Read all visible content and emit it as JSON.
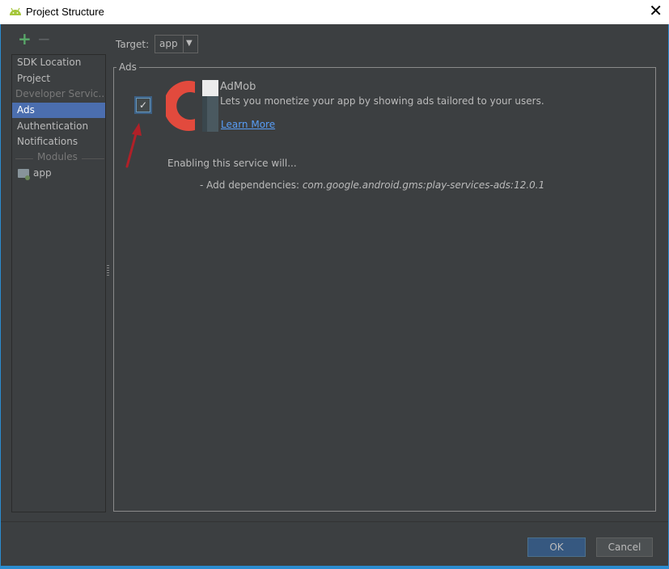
{
  "window": {
    "title": "Project Structure",
    "close_glyph": "✕"
  },
  "toolbar": {
    "add": "+",
    "remove": "−"
  },
  "sidebar": {
    "items": [
      {
        "label": "SDK Location"
      },
      {
        "label": "Project"
      },
      {
        "label": "Developer Servic..."
      },
      {
        "label": "Ads"
      },
      {
        "label": "Authentication"
      },
      {
        "label": "Notifications"
      }
    ],
    "modules_label": "Modules",
    "modules": [
      {
        "label": "app"
      }
    ]
  },
  "target": {
    "label": "Target:",
    "value": "app",
    "arrow": "▼"
  },
  "ads": {
    "group_label": "Ads",
    "enabled": true,
    "check_glyph": "✓",
    "service_name": "AdMob",
    "description": "Lets you monetize your app by showing ads tailored to your users.",
    "learn_more": "Learn More",
    "enabling_text": "Enabling this service will...",
    "dependency_prefix": "- Add dependencies: ",
    "dependency": "com.google.android.gms:play-services-ads:12.0.1"
  },
  "buttons": {
    "ok": "OK",
    "cancel": "Cancel"
  },
  "colors": {
    "accent": "#4b6eaf",
    "brand_red": "#e24a3d",
    "link": "#589df6",
    "annotation_arrow": "#b02028"
  }
}
